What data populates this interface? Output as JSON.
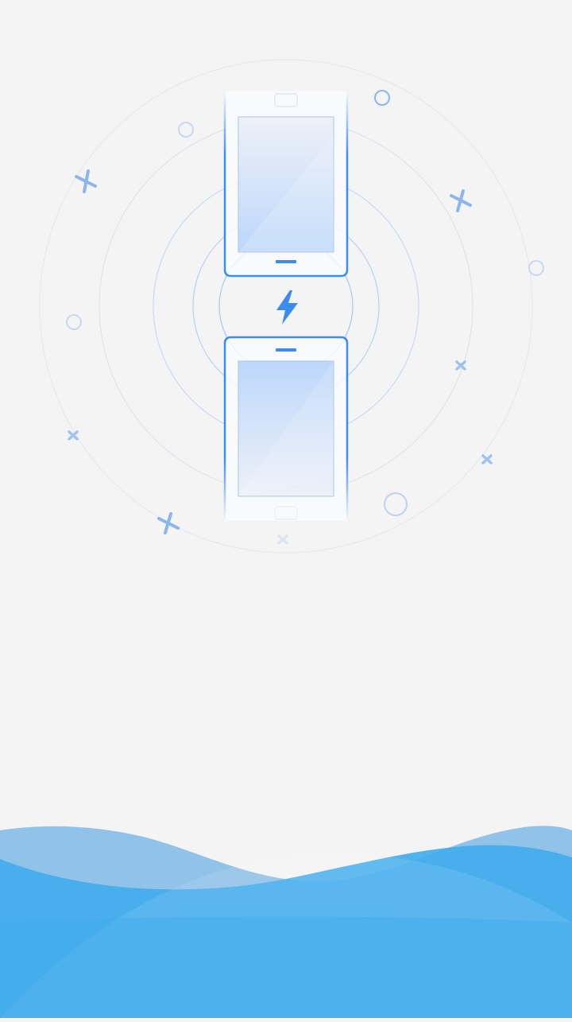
{
  "screen": {
    "name": "phone-transfer-splash",
    "background_color": "#f4f4f4"
  },
  "illustration": {
    "top_device": "phone-outline",
    "bottom_device": "phone-outline",
    "connection_icon": "lightning-bolt-icon",
    "accent_color": "#3b8cef",
    "ring_color": "#8fb9f0",
    "decorations": [
      "x-mark-icon",
      "circle-outline-icon",
      "small-x-mark-icon"
    ]
  },
  "footer_wave": {
    "color_front": "#42adec",
    "color_back": "#91c3e9"
  }
}
